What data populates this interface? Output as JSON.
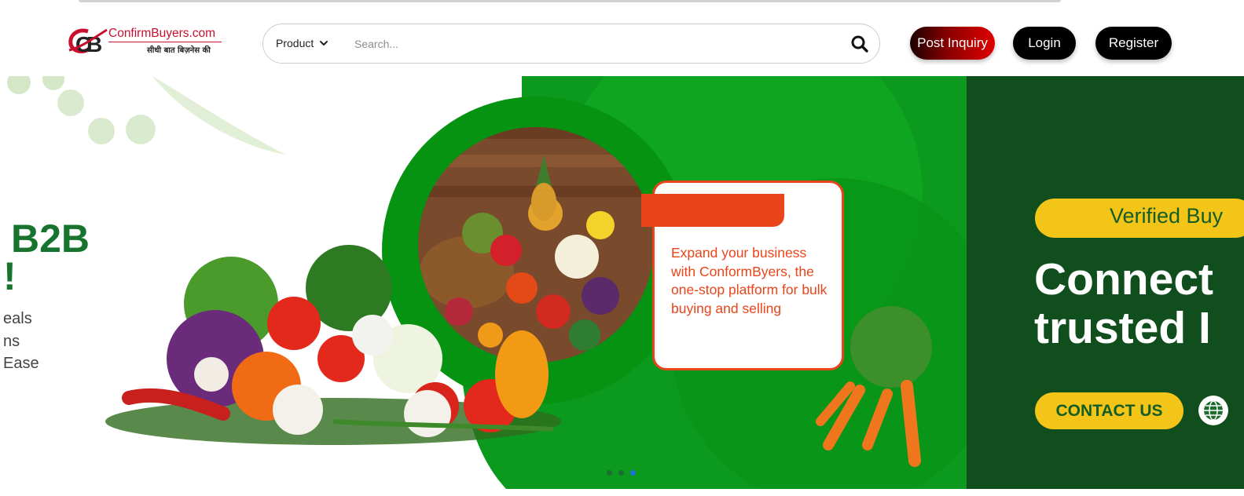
{
  "header": {
    "logo": {
      "name": "ConfirmBuyers.com",
      "tagline": "सीधी बात बिज़नेस की",
      "brand_color": "#c8102e"
    },
    "search": {
      "category_label": "Product",
      "placeholder": "Search..."
    },
    "buttons": {
      "post_inquiry": "Post Inquiry",
      "login": "Login",
      "register": "Register"
    }
  },
  "banner": {
    "left_slide": {
      "heading_fragment": "B2B",
      "heading_fragment_2": "!",
      "lines": [
        "eals",
        "ns",
        "Ease"
      ]
    },
    "promo": {
      "text": "Expand your business with ConformByers, the one-stop platform for bulk buying and selling",
      "accent_color": "#e9441a"
    },
    "right_slide": {
      "pill_text": "Verified Buy",
      "headline_line1": "Connect",
      "headline_line2": "trusted I",
      "cta_label": "CONTACT US",
      "panel_color": "#104e1e",
      "cta_color": "#f2c518"
    },
    "carousel": {
      "total": 3,
      "active_index": 2
    },
    "icons": [
      "search-icon",
      "chevron-down-icon",
      "globe-icon"
    ]
  }
}
